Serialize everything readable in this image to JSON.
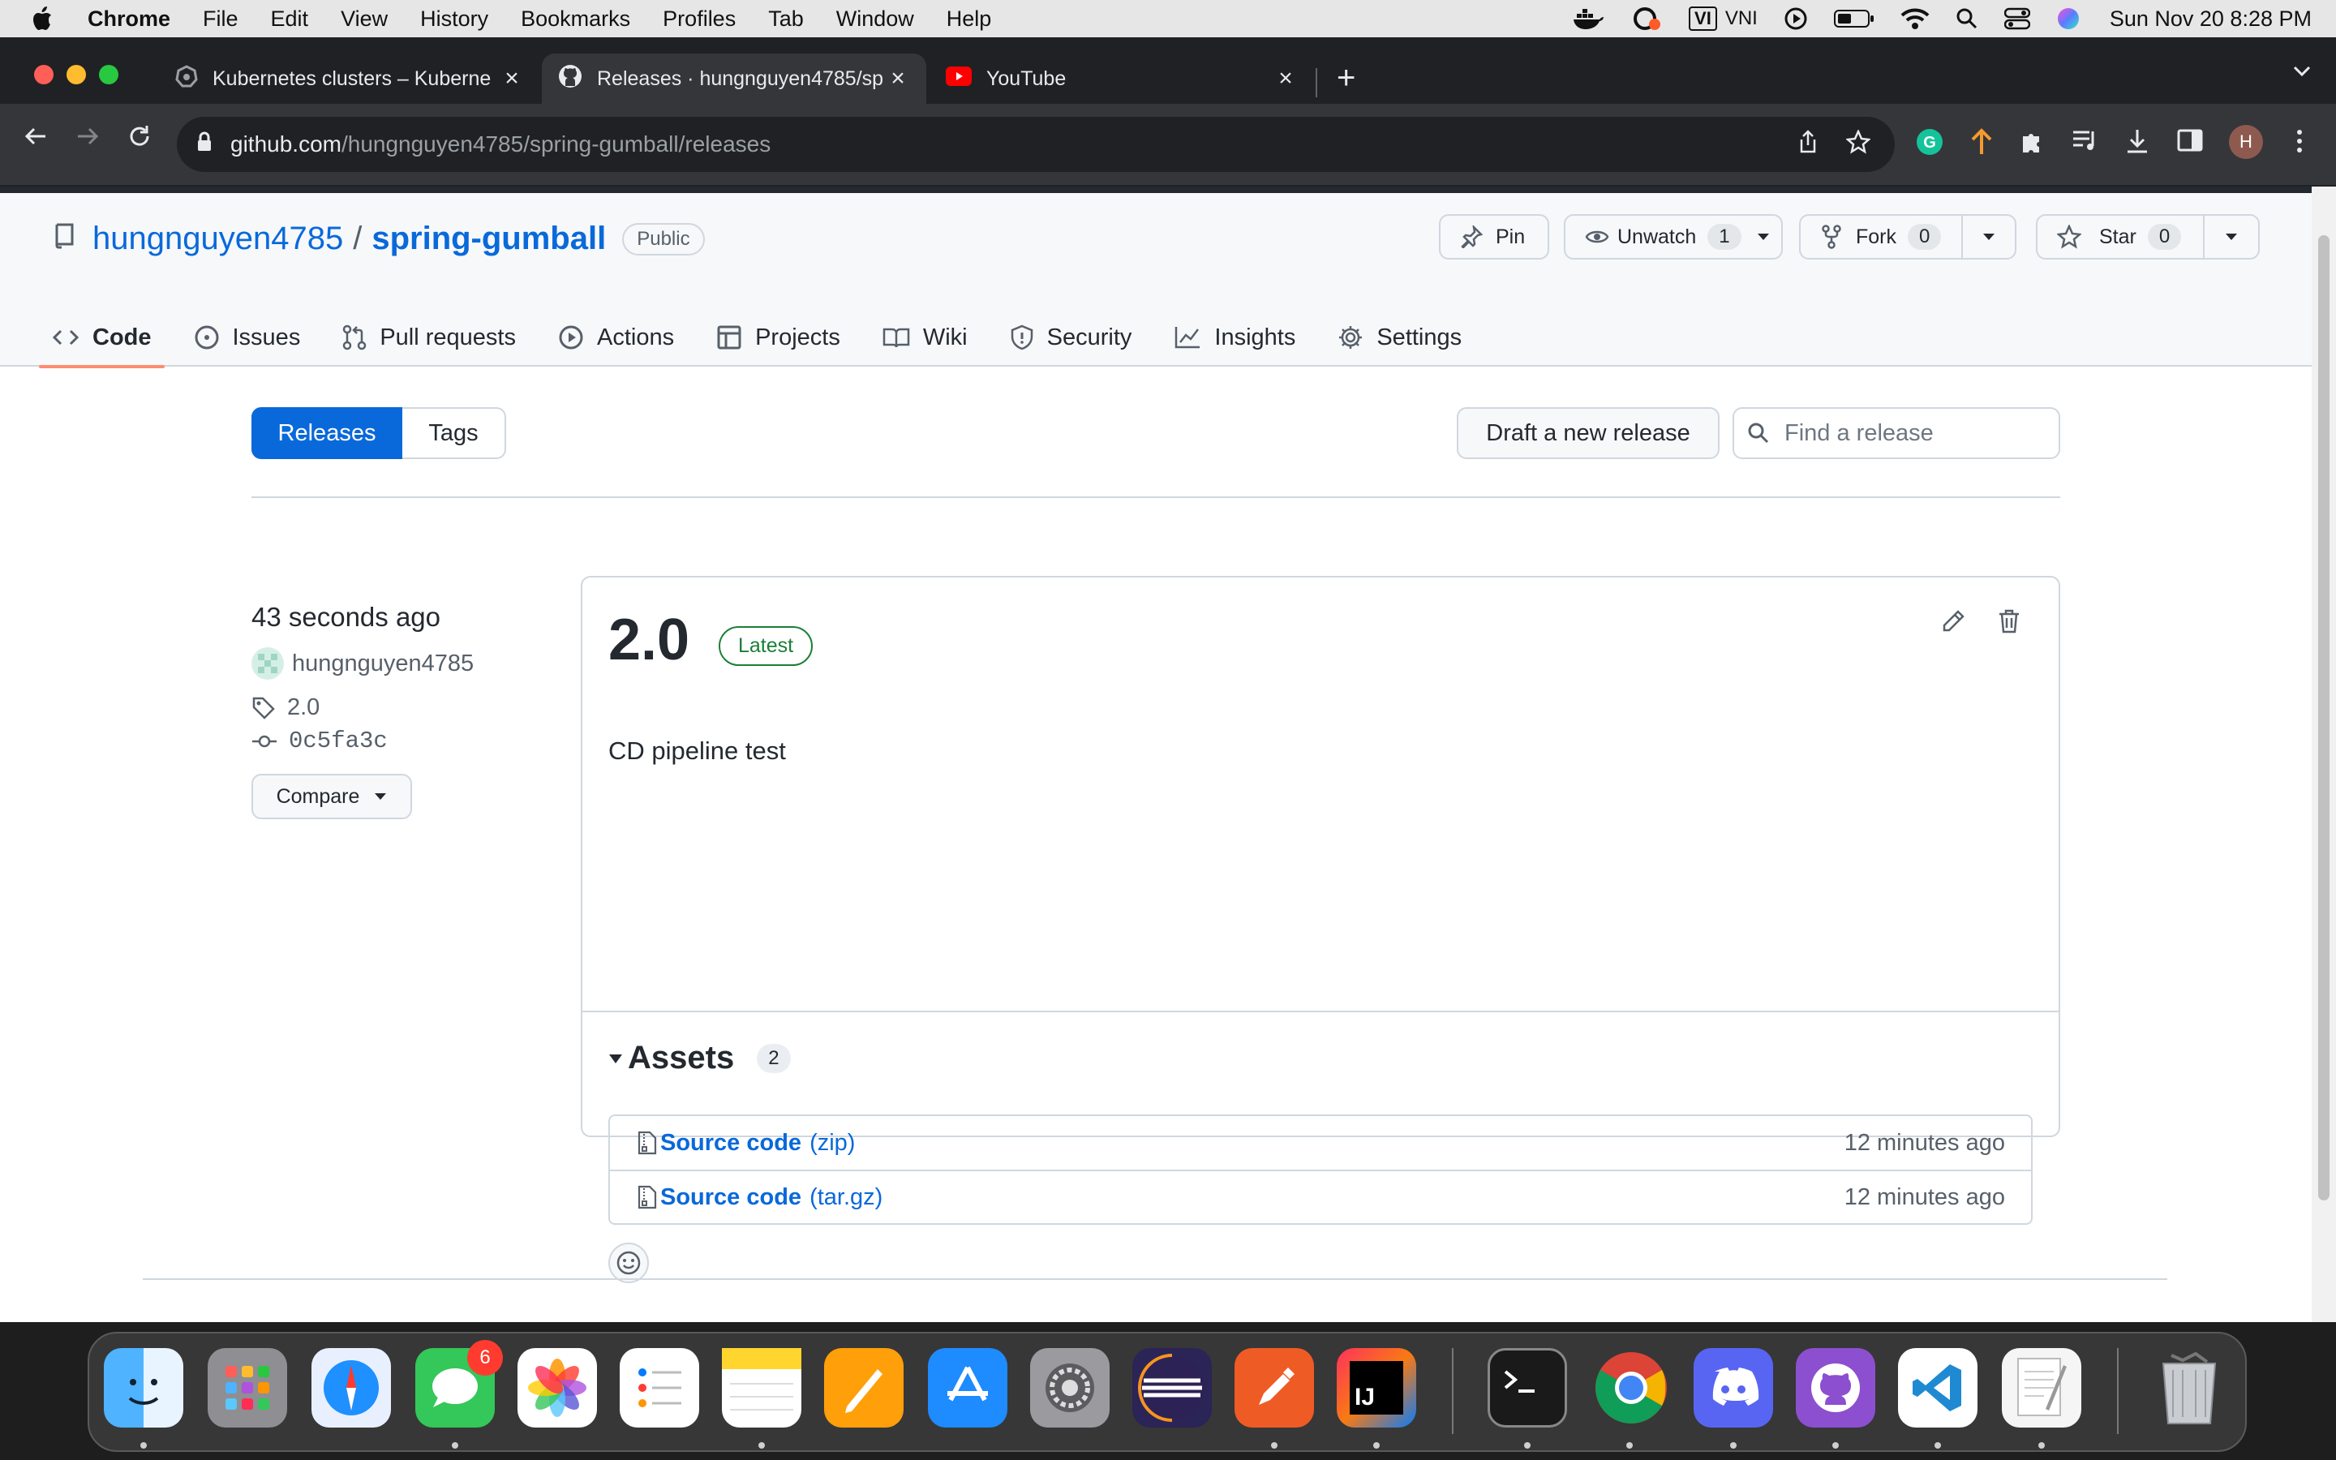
{
  "menubar": {
    "app": "Chrome",
    "items": [
      "File",
      "Edit",
      "View",
      "History",
      "Bookmarks",
      "Profiles",
      "Tab",
      "Window",
      "Help"
    ],
    "vi_label": "VI",
    "input_method": "VNI",
    "clock": "Sun Nov 20  8:28 PM"
  },
  "browser": {
    "tabs": [
      {
        "title": "Kubernetes clusters – Kuberne",
        "icon": "kubernetes-icon"
      },
      {
        "title": "Releases · hungnguyen4785/sp",
        "icon": "github-icon"
      },
      {
        "title": "YouTube",
        "icon": "youtube-icon"
      }
    ],
    "url_host": "github.com",
    "url_path": "/hungnguyen4785/spring-gumball/releases",
    "profile_initial": "H"
  },
  "repo": {
    "owner": "hungnguyen4785",
    "separator": "/",
    "name": "spring-gumball",
    "visibility": "Public",
    "pin_label": "Pin",
    "watch_label": "Unwatch",
    "watch_count": "1",
    "fork_label": "Fork",
    "fork_count": "0",
    "star_label": "Star",
    "star_count": "0",
    "nav": [
      {
        "label": "Code",
        "icon": "code-icon"
      },
      {
        "label": "Issues",
        "icon": "issue-icon"
      },
      {
        "label": "Pull requests",
        "icon": "pull-request-icon"
      },
      {
        "label": "Actions",
        "icon": "play-icon"
      },
      {
        "label": "Projects",
        "icon": "table-icon"
      },
      {
        "label": "Wiki",
        "icon": "book-icon"
      },
      {
        "label": "Security",
        "icon": "shield-icon"
      },
      {
        "label": "Insights",
        "icon": "graph-icon"
      },
      {
        "label": "Settings",
        "icon": "gear-icon"
      }
    ]
  },
  "releases_page": {
    "tab_releases": "Releases",
    "tab_tags": "Tags",
    "draft_button": "Draft a new release",
    "search_placeholder": "Find a release"
  },
  "release": {
    "time_ago": "43 seconds ago",
    "author": "hungnguyen4785",
    "tag": "2.0",
    "commit": "0c5fa3c",
    "compare_label": "Compare",
    "version": "2.0",
    "latest_label": "Latest",
    "description": "CD pipeline test",
    "assets_title": "Assets",
    "assets_count": "2",
    "assets": [
      {
        "name": "Source code",
        "ext": "(zip)",
        "time": "12 minutes ago"
      },
      {
        "name": "Source code",
        "ext": "(tar.gz)",
        "time": "12 minutes ago"
      }
    ]
  },
  "dock": {
    "messages_badge": "6",
    "intellij_label": "IJ"
  },
  "colors": {
    "link": "#0969da",
    "primary_button": "#0969da",
    "latest_green": "#1a7f37",
    "selected_tab_underline": "#fd8c73"
  }
}
